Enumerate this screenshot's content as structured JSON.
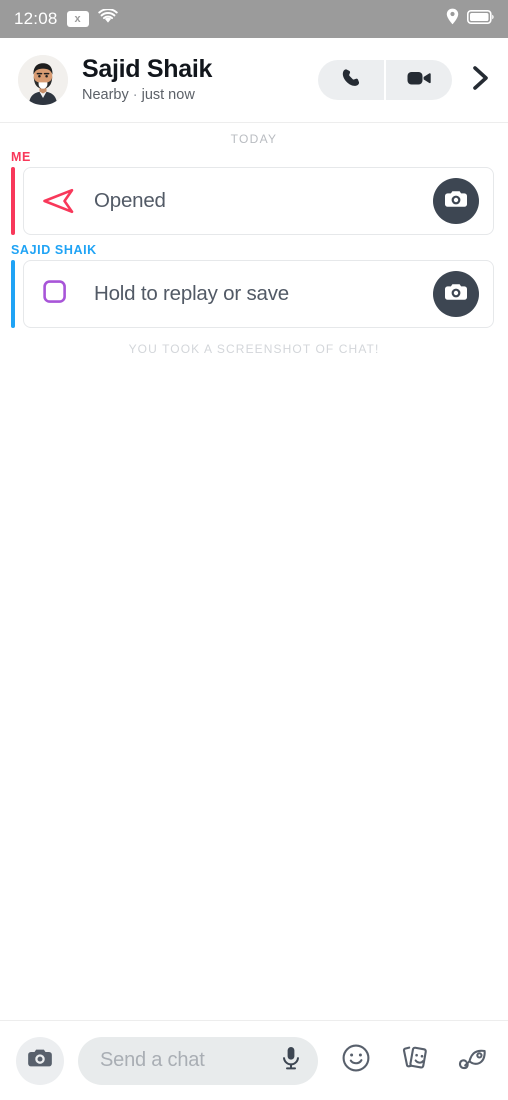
{
  "statusbar": {
    "time": "12:08",
    "nosim_label": "x",
    "icons": [
      "no-sim-icon",
      "wifi-icon",
      "location-pin-icon",
      "battery-icon"
    ]
  },
  "header": {
    "name": "Sajid Shaik",
    "status": "Nearby",
    "separator": "·",
    "timestamp": "just now",
    "call_button": "phone-icon",
    "video_button": "video-camera-icon",
    "forward_button": "chevron-right-icon"
  },
  "conversation": {
    "date_divider": "TODAY",
    "messages": [
      {
        "sender_label": "ME",
        "sender_type": "me",
        "accent_color": "#f8385a",
        "status_icon": "snap-arrow-outline-icon",
        "icon_color": "#f8385a",
        "text": "Opened",
        "action_icon": "camera-icon"
      },
      {
        "sender_label": "SAJID SHAIK",
        "sender_type": "them",
        "accent_color": "#1fa3f5",
        "status_icon": "chat-square-outline-icon",
        "icon_color": "#a855d8",
        "text": "Hold to replay or save",
        "action_icon": "camera-icon"
      }
    ],
    "system_note": "YOU TOOK A SCREENSHOT OF CHAT!"
  },
  "bottombar": {
    "camera_button": "camera-icon",
    "input_placeholder": "Send a chat",
    "input_value": "",
    "mic_button": "microphone-icon",
    "actions": [
      {
        "name": "smiley-icon"
      },
      {
        "name": "stickers-icon"
      },
      {
        "name": "rocket-icon"
      }
    ]
  },
  "colors": {
    "accent_me": "#f8385a",
    "accent_them": "#1fa3f5",
    "icon_purple": "#a855d8",
    "dark_slate": "#3d4652",
    "status_bar": "#9b9b9b"
  }
}
